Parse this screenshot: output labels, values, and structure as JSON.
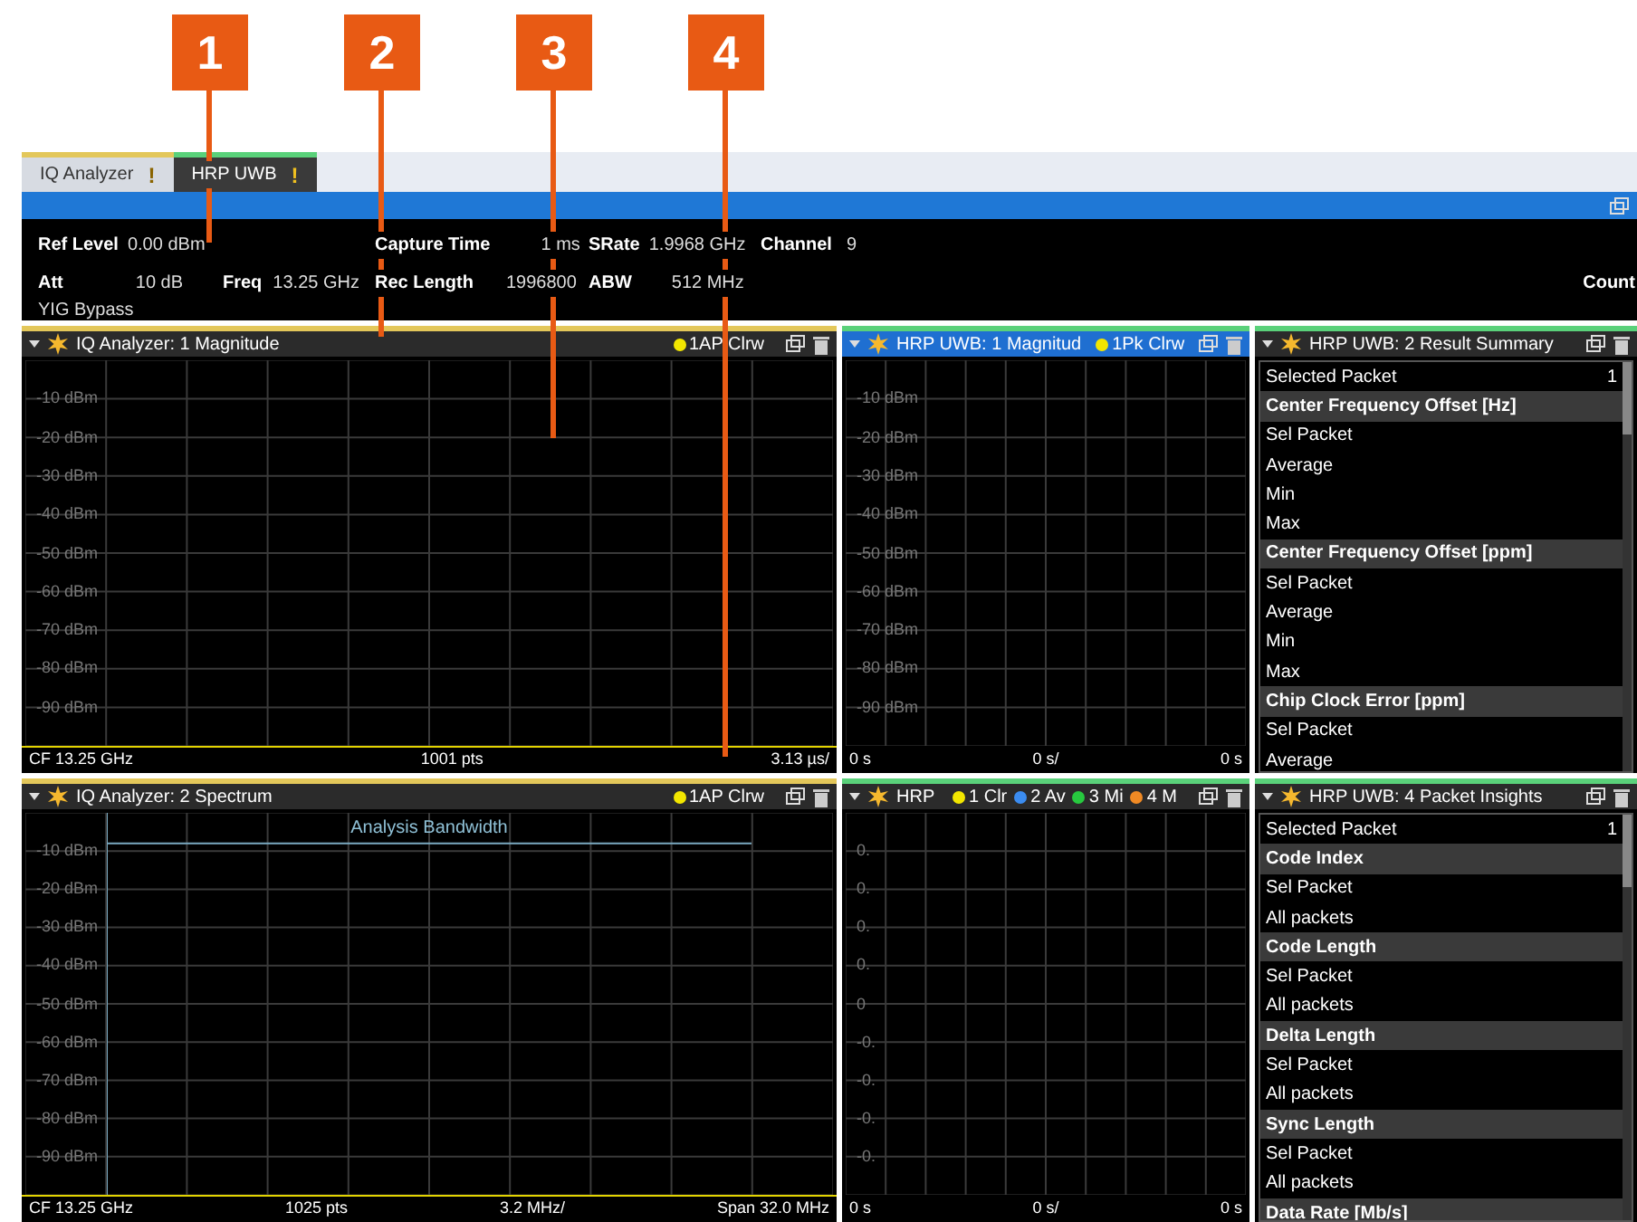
{
  "callouts": [
    {
      "label": "1"
    },
    {
      "label": "2"
    },
    {
      "label": "3"
    },
    {
      "label": "4"
    }
  ],
  "tabs": [
    {
      "label": "IQ Analyzer",
      "badge": "!",
      "selected": false,
      "color": "#e3c75a"
    },
    {
      "label": "HRP UWB",
      "badge": "!",
      "selected": true,
      "color": "#5ad17a"
    }
  ],
  "info": {
    "rows": [
      [
        {
          "label": "Ref Level",
          "value": "0.00 dBm"
        },
        null,
        {
          "label": "Capture Time",
          "value": "1 ms"
        },
        {
          "label": "SRate",
          "value": "1.9968 GHz"
        },
        {
          "label": "Channel",
          "value": "9"
        }
      ],
      [
        {
          "label": "Att",
          "value": "10 dB"
        },
        {
          "label": "Freq",
          "value": "13.25 GHz"
        },
        {
          "label": "Rec Length",
          "value": "1996800"
        },
        {
          "label": "ABW",
          "value": "512 MHz"
        },
        null
      ]
    ],
    "count_label": "Count",
    "note": "YIG Bypass"
  },
  "panes": [
    {
      "kind": "plot",
      "title": "IQ Analyzer: 1 Magnitude",
      "color": "#e3c75a",
      "selected": false,
      "traces": [
        {
          "label": "1AP Clrw",
          "color": "#f2e600"
        }
      ],
      "y_labels": [
        "-10 dBm",
        "-20 dBm",
        "-30 dBm",
        "-40 dBm",
        "-50 dBm",
        "-60 dBm",
        "-70 dBm",
        "-80 dBm",
        "-90 dBm"
      ],
      "footer": [
        "CF 13.25 GHz",
        "1001 pts",
        "3.13 µs/"
      ]
    },
    {
      "kind": "plot",
      "title": "HRP UWB: 1 Magnitud",
      "color": "#5ad17a",
      "selected": true,
      "traces": [
        {
          "label": "1Pk Clrw",
          "color": "#f2e600"
        }
      ],
      "y_labels": [
        "-10 dBm",
        "-20 dBm",
        "-30 dBm",
        "-40 dBm",
        "-50 dBm",
        "-60 dBm",
        "-70 dBm",
        "-80 dBm",
        "-90 dBm"
      ],
      "footer": [
        "0 s",
        "0 s/",
        "0 s"
      ]
    },
    {
      "kind": "table",
      "title": "HRP UWB: 2 Result Summary",
      "color": "#5ad17a",
      "selected": false,
      "rows": [
        {
          "kind": "item",
          "label": "Selected Packet",
          "value": "1"
        },
        {
          "kind": "header",
          "label": "Center Frequency Offset [Hz]"
        },
        {
          "kind": "item",
          "label": "Sel Packet"
        },
        {
          "kind": "item",
          "label": "Average"
        },
        {
          "kind": "item",
          "label": "Min"
        },
        {
          "kind": "item",
          "label": "Max"
        },
        {
          "kind": "header",
          "label": "Center Frequency Offset [ppm]"
        },
        {
          "kind": "item",
          "label": "Sel Packet"
        },
        {
          "kind": "item",
          "label": "Average"
        },
        {
          "kind": "item",
          "label": "Min"
        },
        {
          "kind": "item",
          "label": "Max"
        },
        {
          "kind": "header",
          "label": "Chip Clock Error [ppm]"
        },
        {
          "kind": "item",
          "label": "Sel Packet"
        },
        {
          "kind": "item",
          "label": "Average"
        }
      ]
    },
    {
      "kind": "plot",
      "title": "IQ Analyzer: 2 Spectrum",
      "color": "#e3c75a",
      "selected": false,
      "traces": [
        {
          "label": "1AP Clrw",
          "color": "#f2e600"
        }
      ],
      "marker_label": "Analysis Bandwidth",
      "y_labels": [
        "-10 dBm",
        "-20 dBm",
        "-30 dBm",
        "-40 dBm",
        "-50 dBm",
        "-60 dBm",
        "-70 dBm",
        "-80 dBm",
        "-90 dBm"
      ],
      "footer": [
        "CF 13.25 GHz",
        "1025 pts",
        "3.2 MHz/",
        "Span 32.0 MHz"
      ]
    },
    {
      "kind": "plot",
      "title": "HRP",
      "color": "#5ad17a",
      "selected": false,
      "traces": [
        {
          "label": "1 Clr",
          "color": "#f2e600"
        },
        {
          "label": "2 Av",
          "color": "#3b8cf0"
        },
        {
          "label": "3 Mi",
          "color": "#27c93f"
        },
        {
          "label": "4 M",
          "color": "#f08a24"
        }
      ],
      "y_labels": [
        "0.",
        "0.",
        "0.",
        "0.",
        "0",
        "-0.",
        "-0.",
        "-0.",
        "-0."
      ],
      "footer": [
        "0 s",
        "0 s/",
        "0 s"
      ]
    },
    {
      "kind": "table",
      "title": "HRP UWB: 4 Packet Insights",
      "color": "#5ad17a",
      "selected": false,
      "rows": [
        {
          "kind": "item",
          "label": "Selected Packet",
          "value": "1"
        },
        {
          "kind": "header",
          "label": "Code Index"
        },
        {
          "kind": "item",
          "label": "Sel Packet"
        },
        {
          "kind": "item",
          "label": "All packets"
        },
        {
          "kind": "header",
          "label": "Code Length"
        },
        {
          "kind": "item",
          "label": "Sel Packet"
        },
        {
          "kind": "item",
          "label": "All packets"
        },
        {
          "kind": "header",
          "label": "Delta Length"
        },
        {
          "kind": "item",
          "label": "Sel Packet"
        },
        {
          "kind": "item",
          "label": "All packets"
        },
        {
          "kind": "header",
          "label": "Sync Length"
        },
        {
          "kind": "item",
          "label": "Sel Packet"
        },
        {
          "kind": "item",
          "label": "All packets"
        },
        {
          "kind": "header",
          "label": "Data Rate [Mb/s]"
        }
      ]
    }
  ]
}
